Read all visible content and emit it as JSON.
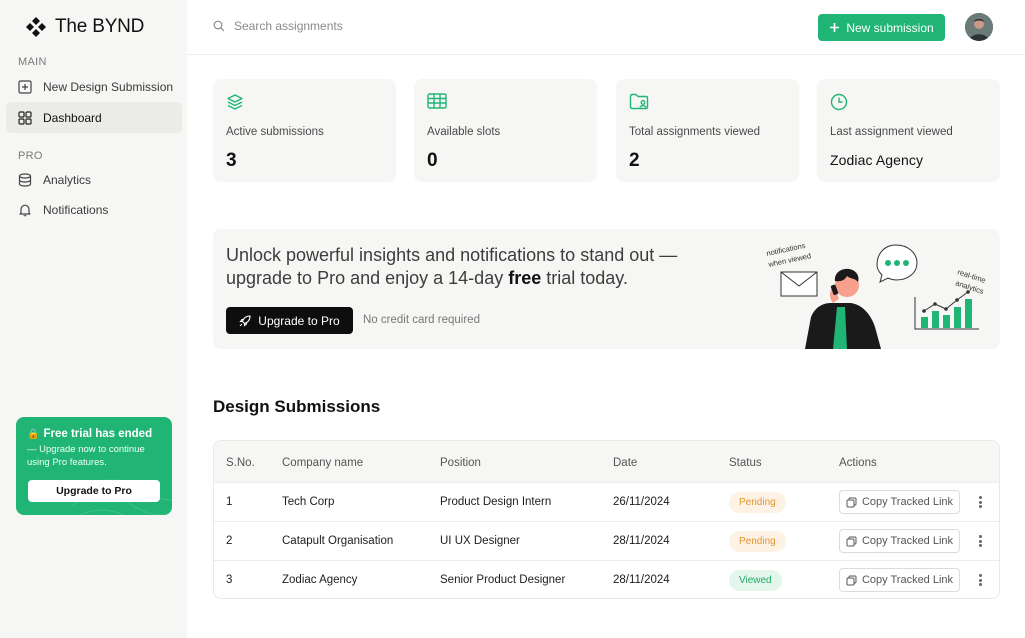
{
  "app": {
    "name": "The BYND"
  },
  "sidebar": {
    "main_label": "MAIN",
    "pro_label": "PRO",
    "items": [
      {
        "label": "New Design Submission",
        "icon": "plus-square-icon"
      },
      {
        "label": "Dashboard",
        "icon": "grid-icon",
        "active": true
      },
      {
        "label": "Analytics",
        "icon": "database-icon"
      },
      {
        "label": "Notifications",
        "icon": "bell-icon"
      }
    ],
    "trial": {
      "title": "Free trial has ended",
      "text": "— Upgrade now to continue using Pro features.",
      "button": "Upgrade to Pro"
    }
  },
  "header": {
    "search_placeholder": "Search assignments",
    "new_button": "New submission"
  },
  "stats": [
    {
      "label": "Active submissions",
      "value": "3",
      "icon": "layers-icon"
    },
    {
      "label": "Available slots",
      "value": "0",
      "icon": "table-icon"
    },
    {
      "label": "Total assignments viewed",
      "value": "2",
      "icon": "folder-user-icon"
    },
    {
      "label": "Last assignment viewed",
      "value": "Zodiac Agency",
      "icon": "clock-icon"
    }
  ],
  "promo": {
    "text_before": "Unlock powerful insights and notifications to stand out — upgrade to Pro and enjoy a 14-day ",
    "text_bold": "free",
    "text_after": " trial today.",
    "button": "Upgrade to Pro",
    "note": "No credit card required",
    "illustration_label_1": "notifications when viewed",
    "illustration_label_2": "real-time analytics"
  },
  "submissions": {
    "title": "Design Submissions",
    "columns": [
      "S.No.",
      "Company name",
      "Position",
      "Date",
      "Status",
      "Actions"
    ],
    "rows": [
      {
        "sno": "1",
        "company": "Tech Corp",
        "position": "Product Design Intern",
        "date": "26/11/2024",
        "status": "Pending",
        "action": "Copy Tracked Link"
      },
      {
        "sno": "2",
        "company": "Catapult Organisation",
        "position": "UI UX Designer",
        "date": "28/11/2024",
        "status": "Pending",
        "action": "Copy Tracked Link"
      },
      {
        "sno": "3",
        "company": "Zodiac Agency",
        "position": "Senior Product Designer",
        "date": "28/11/2024",
        "status": "Viewed",
        "action": "Copy Tracked Link"
      }
    ]
  },
  "colors": {
    "accent": "#20b574",
    "pending": "#e2962f",
    "viewed": "#21a865"
  }
}
